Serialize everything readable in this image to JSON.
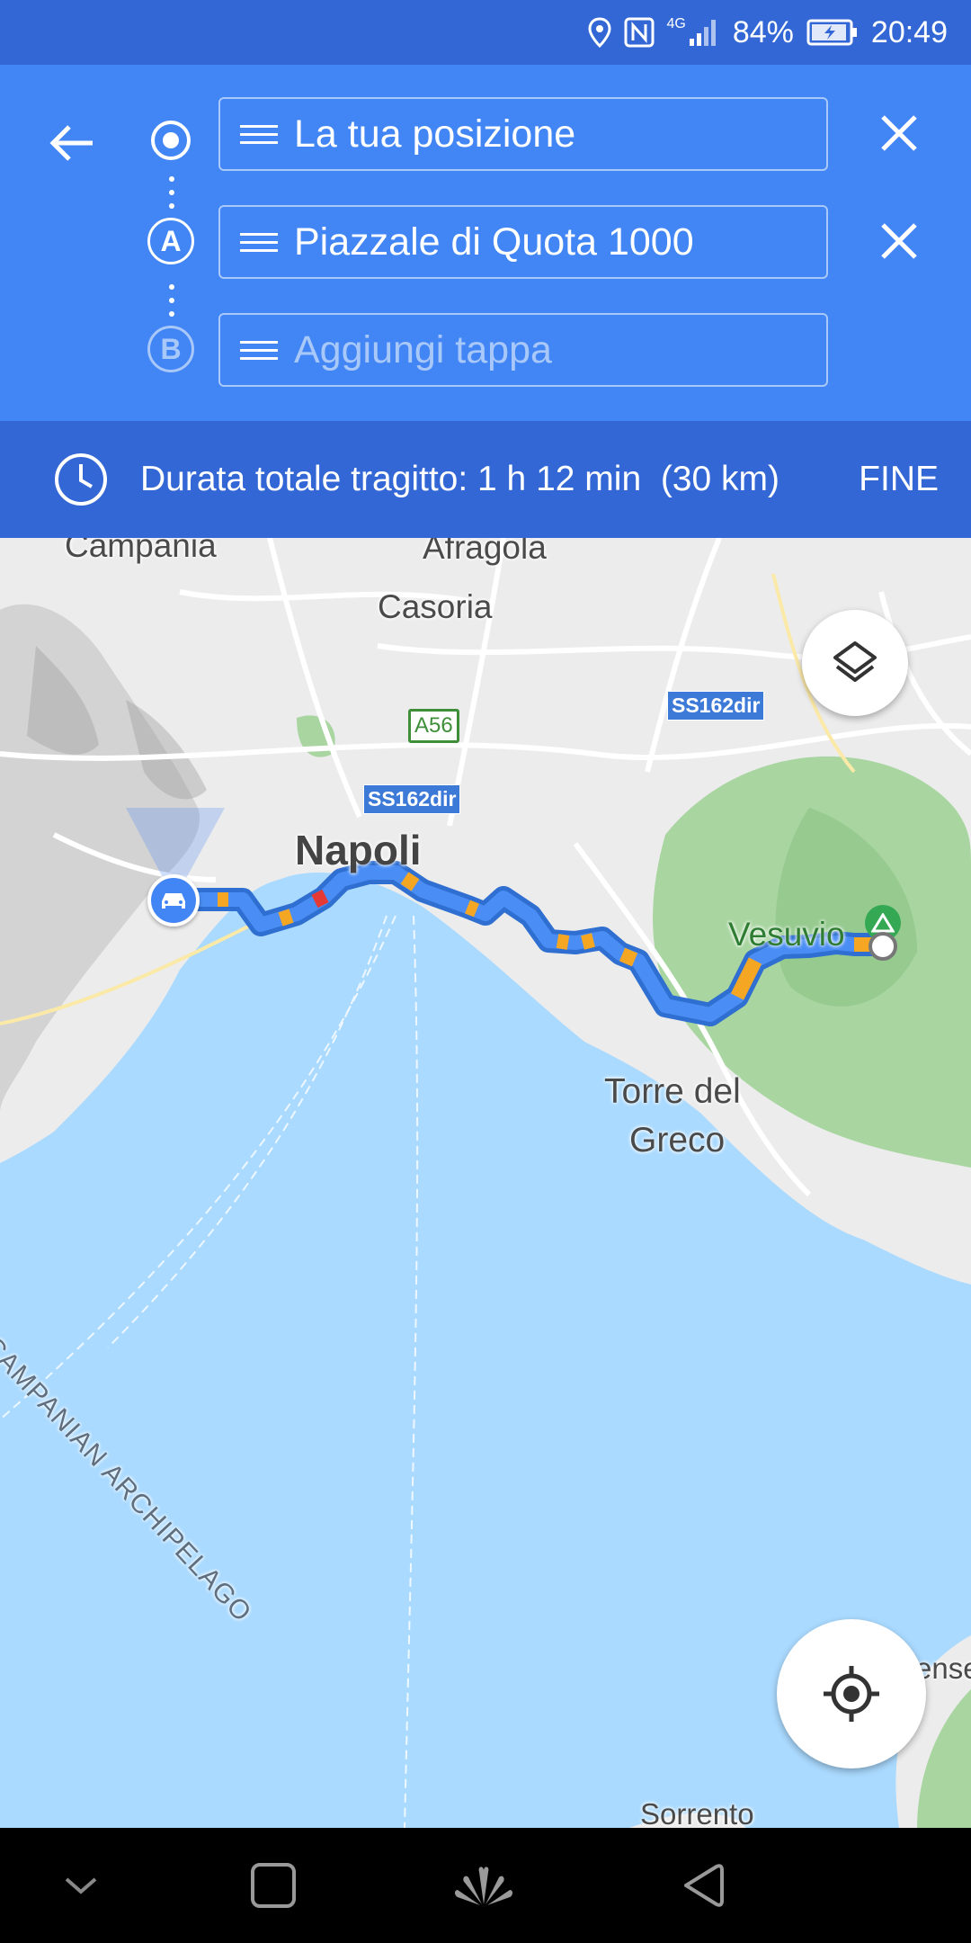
{
  "status_bar": {
    "network": "4G",
    "battery": "84%",
    "time": "20:49"
  },
  "header": {
    "origin": {
      "value": "La tua posizione"
    },
    "destination": {
      "marker": "A",
      "value": "Piazzale di Quota 1000"
    },
    "add_stop": {
      "marker": "B",
      "placeholder": "Aggiungi tappa"
    }
  },
  "summary": {
    "duration": "Durata totale tragitto: 1 h 12 min",
    "distance": "(30 km)",
    "done": "FINE"
  },
  "map": {
    "labels": {
      "campania": "Campania",
      "afragola": "Afragola",
      "casoria": "Casoria",
      "napoli": "Napoli",
      "vesuvio": "Vesuvio",
      "torre_line1": "Torre del",
      "torre_line2": "Greco",
      "archipelago": "CAMPANIAN ARCHIPELAGO",
      "sorrento": "Sorrento",
      "partial_right": "ense"
    },
    "shields": {
      "a56": "A56",
      "ss162_1": "SS162dir",
      "ss162_2": "SS162dir"
    },
    "colors": {
      "route": "#4285f4",
      "traffic_slow": "#f5a623",
      "traffic_jam": "#e53935",
      "water": "#aadaff",
      "land": "#ececec",
      "park": "#a8d5a0"
    }
  },
  "icons": [
    "back-arrow-icon",
    "close-icon",
    "clock-icon",
    "layers-icon",
    "my-location-icon",
    "car-icon",
    "park-pin-icon"
  ]
}
